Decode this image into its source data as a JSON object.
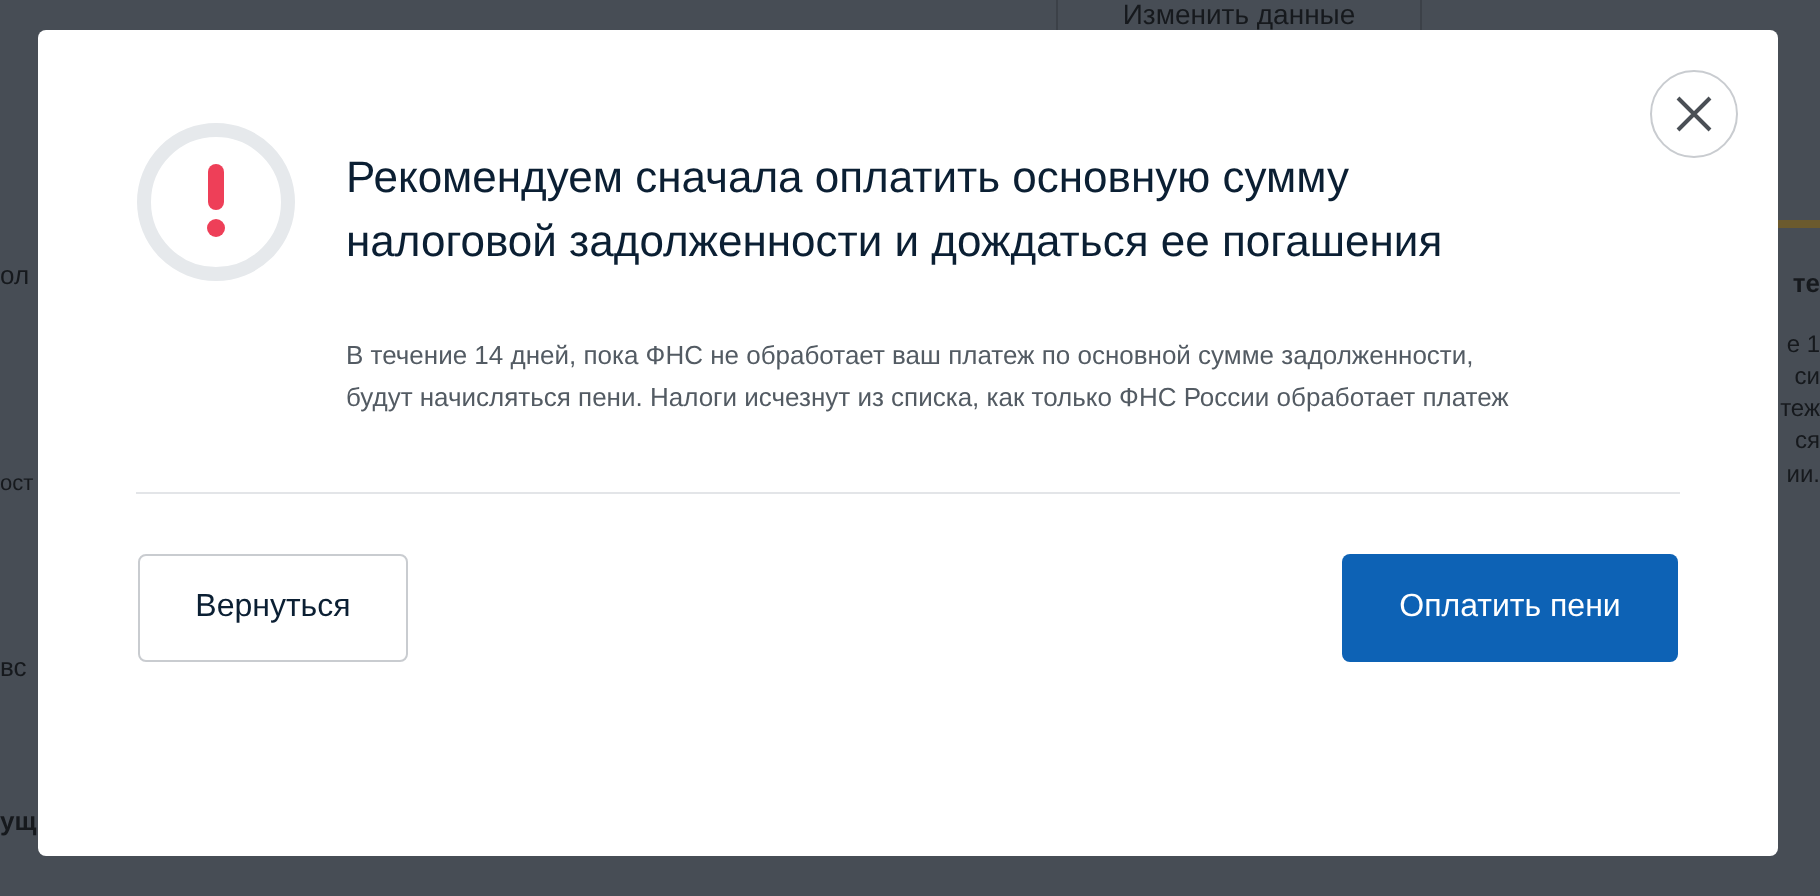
{
  "background": {
    "fragments": [
      {
        "kind": "button",
        "text": "Изменить данные"
      },
      {
        "kind": "left",
        "text": "ол"
      },
      {
        "kind": "left_small",
        "text": "ост"
      },
      {
        "kind": "left",
        "text": "вс"
      },
      {
        "kind": "left_bold",
        "text": "ущ"
      },
      {
        "kind": "right_bold",
        "text": "те"
      },
      {
        "kind": "right",
        "text": "е 1"
      },
      {
        "kind": "right",
        "text": "си"
      },
      {
        "kind": "right",
        "text": "теж"
      },
      {
        "kind": "right",
        "text": "ся"
      },
      {
        "kind": "right",
        "text": "ии."
      }
    ]
  },
  "dialog": {
    "title": "Рекомендуем сначала оплатить основную сумму налоговой задолженности и дождаться ее погашения",
    "message": "В течение 14 дней, пока ФНС не обработает ваш платеж по основной сумме задолженности, будут начисляться пени. Налоги исчезнут из списка, как только ФНС России обработает платеж",
    "buttons": [
      {
        "label": "Вернуться",
        "kind": "secondary"
      },
      {
        "label": "Оплатить пени",
        "kind": "primary"
      }
    ]
  }
}
